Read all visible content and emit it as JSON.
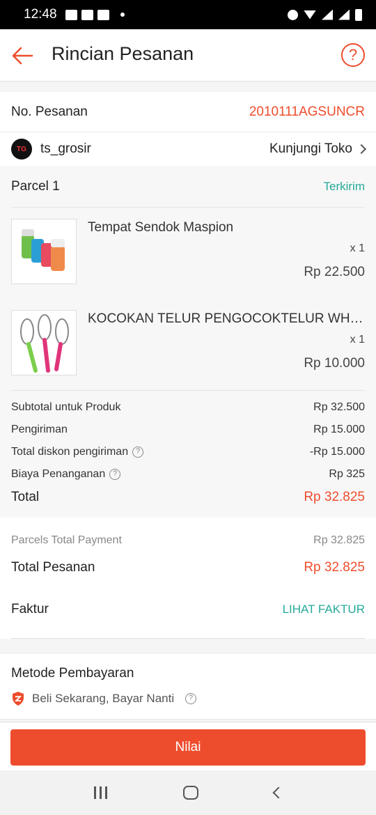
{
  "status_bar": {
    "time": "12:48"
  },
  "header": {
    "title": "Rincian Pesanan"
  },
  "order": {
    "label": "No. Pesanan",
    "number": "2010111AGSUNCR"
  },
  "shop": {
    "name": "ts_grosir",
    "visit_label": "Kunjungi Toko"
  },
  "parcel": {
    "title": "Parcel 1",
    "status": "Terkirim",
    "items": [
      {
        "name": "Tempat Sendok Maspion",
        "qty": "x 1",
        "price": "Rp 22.500"
      },
      {
        "name": "KOCOKAN TELUR PENGOCOKTELUR WHISK",
        "qty": "x 1",
        "price": "Rp 10.000"
      }
    ],
    "summary": {
      "subtotal_label": "Subtotal untuk Produk",
      "subtotal": "Rp 32.500",
      "shipping_label": "Pengiriman",
      "shipping": "Rp 15.000",
      "ship_discount_label": "Total diskon pengiriman",
      "ship_discount": "-Rp 15.000",
      "handling_label": "Biaya Penanganan",
      "handling": "Rp 325",
      "total_label": "Total",
      "total": "Rp 32.825"
    }
  },
  "payment": {
    "parcels_total_label": "Parcels Total Payment",
    "parcels_total": "Rp 32.825",
    "order_total_label": "Total Pesanan",
    "order_total": "Rp 32.825",
    "invoice_label": "Faktur",
    "invoice_link": "LIHAT FAKTUR"
  },
  "method": {
    "title": "Metode Pembayaran",
    "value": "Beli Sekarang, Bayar Nanti"
  },
  "action": {
    "button_label": "Nilai"
  },
  "colors": {
    "accent": "#ee4d2d",
    "teal": "#26aa99"
  }
}
